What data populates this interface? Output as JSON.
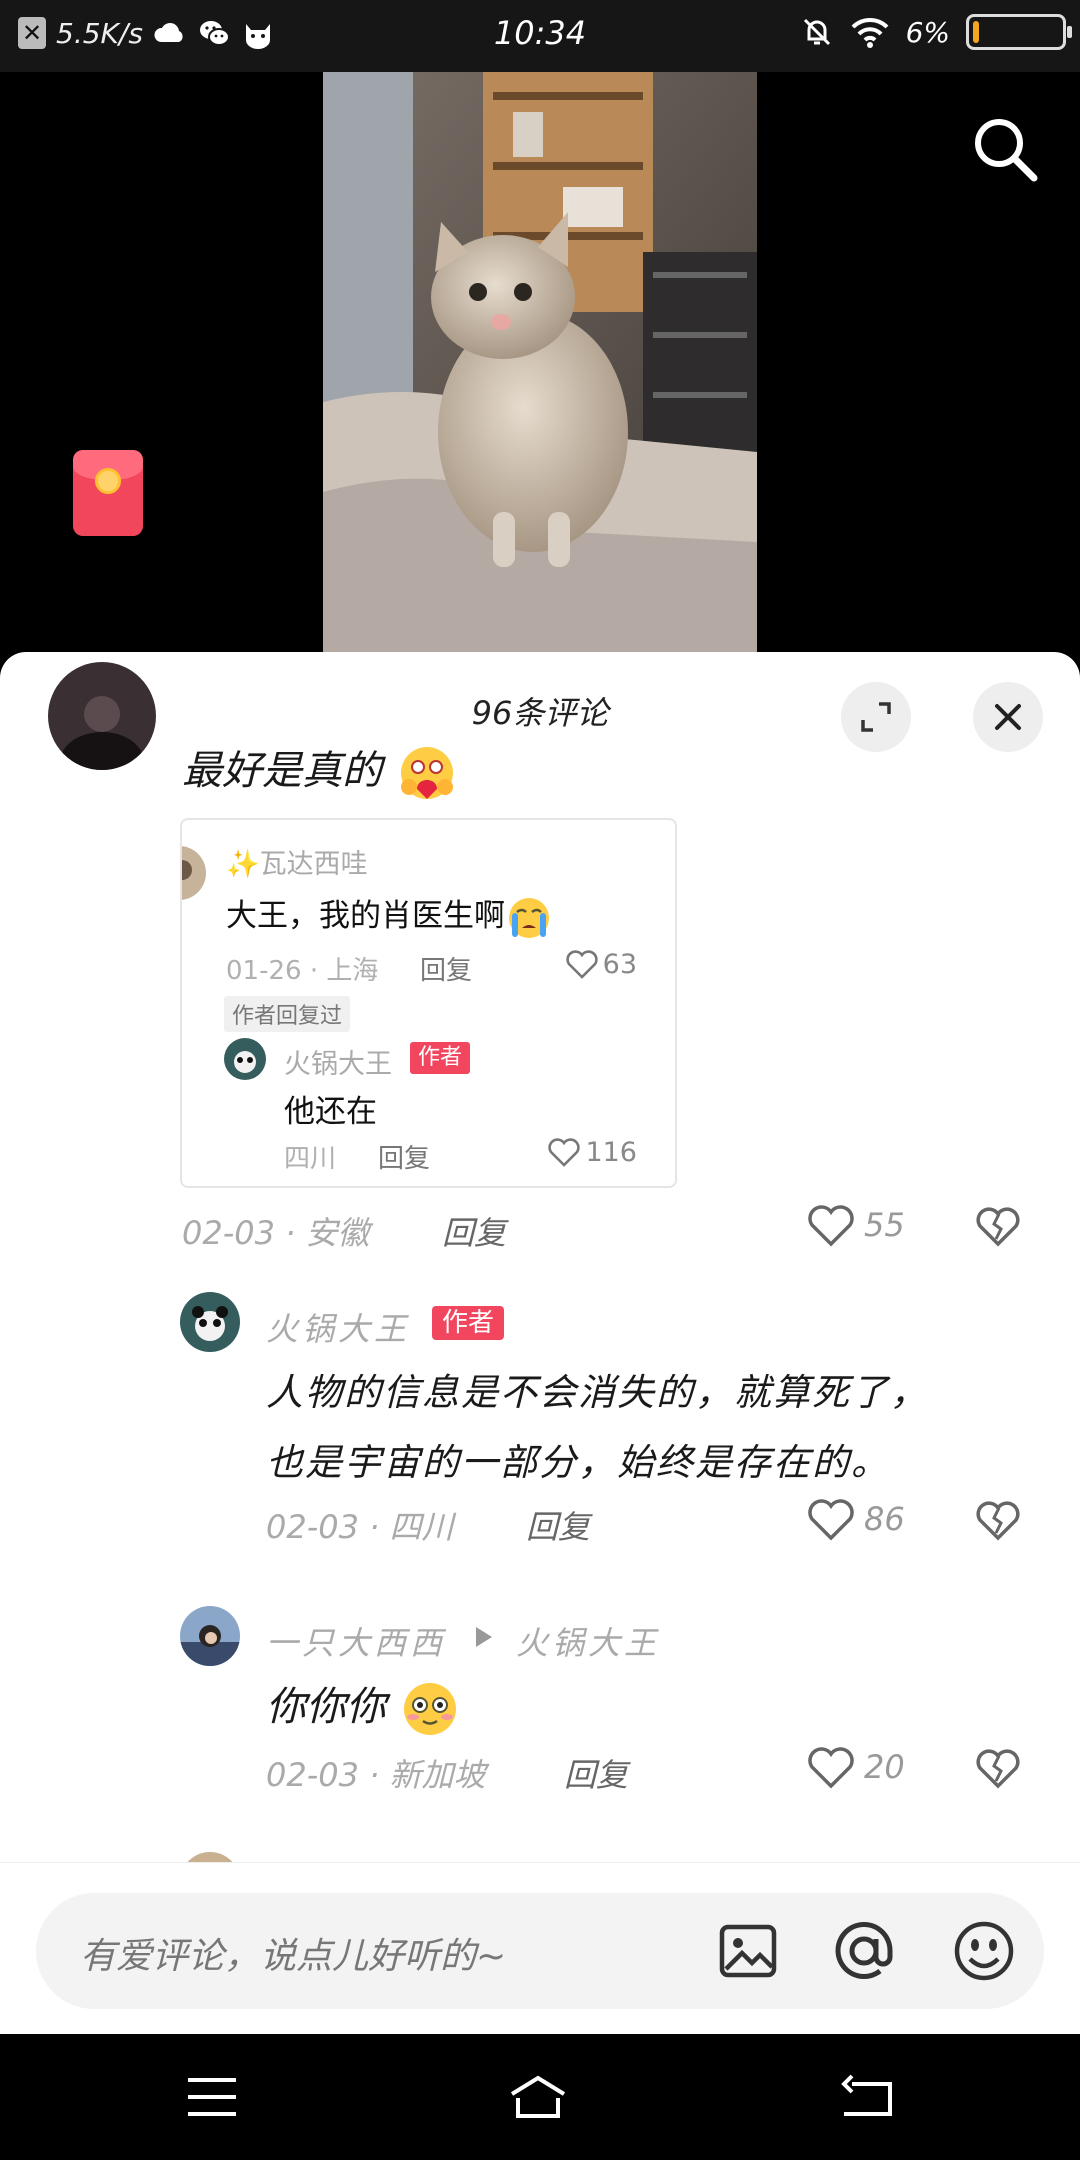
{
  "status_bar": {
    "net_speed": "5.5K/s",
    "time": "10:34",
    "battery_text": "6%",
    "battery_level": 0.06
  },
  "sheet": {
    "title": "96条评论"
  },
  "comments": {
    "first": {
      "text": "最好是真的",
      "date_loc": "02-03 · 安徽",
      "reply_label": "回复",
      "likes": "55"
    },
    "quote": {
      "name": "✨瓦达西哇",
      "text": "大王，我的肖医生啊",
      "date_loc": "01-26 · 上海",
      "reply_label": "回复",
      "likes": "63",
      "badge": "作者回复过",
      "sub_name": "火锅大王",
      "sub_tag": "作者",
      "sub_text": "他还在",
      "sub_loc": "四川",
      "sub_reply_label": "回复",
      "sub_likes": "116"
    },
    "second": {
      "name": "火锅大王",
      "tag": "作者",
      "text_line1": "人物的信息是不会消失的，就算死了，",
      "text_line2": "也是宇宙的一部分，始终是存在的。",
      "date_loc": "02-03 · 四川",
      "reply_label": "回复",
      "likes": "86"
    },
    "third": {
      "name": "一只大西西",
      "reply_to": "火锅大王",
      "text": "你你你",
      "date_loc": "02-03 · 新加坡",
      "reply_label": "回复",
      "likes": "20"
    }
  },
  "input": {
    "placeholder": "有爱评论，说点儿好听的~"
  },
  "colors": {
    "accent": "#f2455e",
    "battery_fill": "#f5a623"
  },
  "icons": [
    "search-icon",
    "red-packet-icon",
    "expand-icon",
    "close-icon",
    "heart-icon",
    "broken-heart-icon",
    "image-icon",
    "at-icon",
    "emoji-icon",
    "menu-icon",
    "home-icon",
    "back-icon"
  ]
}
